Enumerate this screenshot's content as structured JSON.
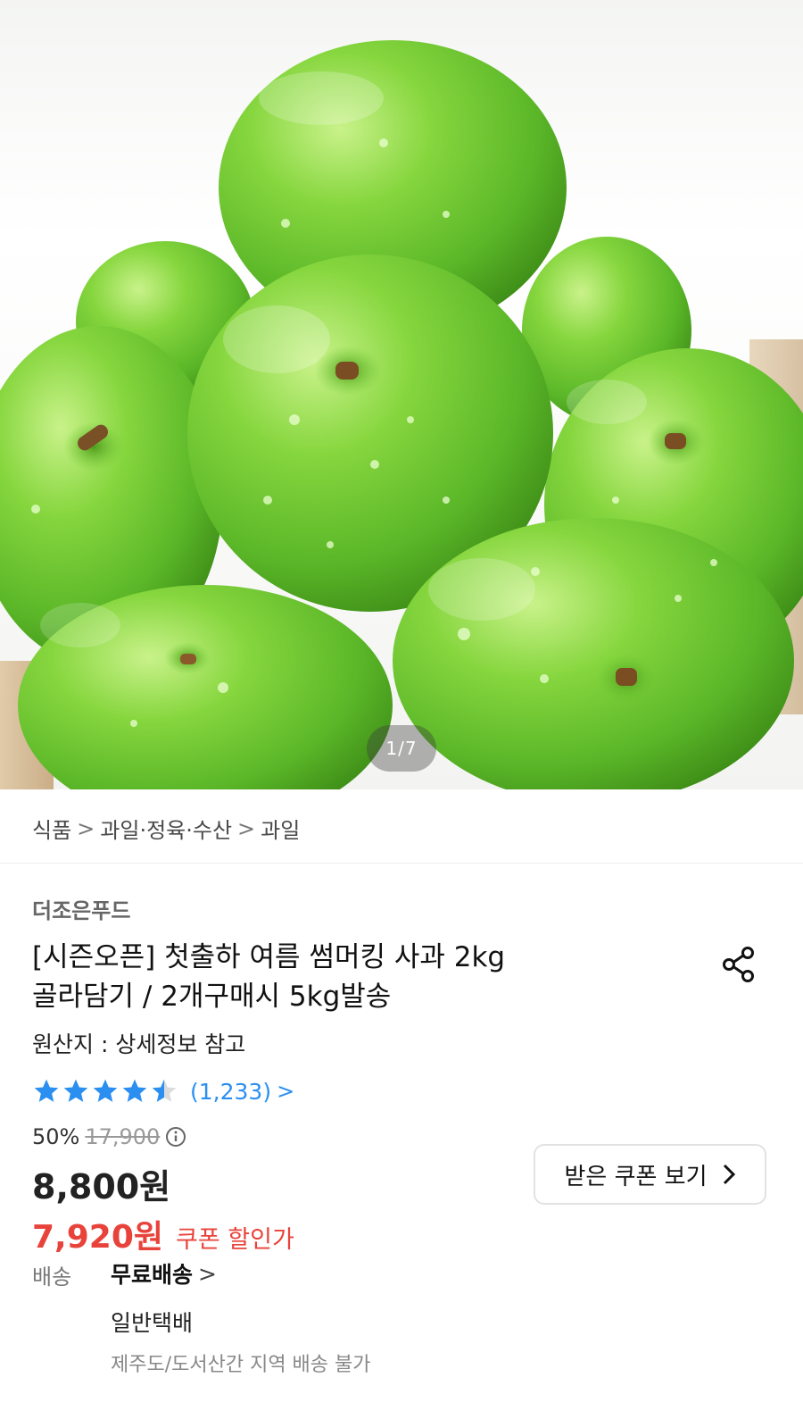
{
  "gallery": {
    "counter": "1/7",
    "image_subject": "green-apples"
  },
  "breadcrumb": {
    "items": [
      "식품",
      "과일·정육·수산",
      "과일"
    ],
    "separator": ">"
  },
  "product": {
    "seller": "더조은푸드",
    "title_line1": "[시즌오픈] 첫출하 여름 썸머킹 사과 2kg",
    "title_line2": "골라담기 / 2개구매시 5kg발송",
    "origin": "원산지 : 상세정보 참고",
    "rating": {
      "stars": 4.5,
      "max_stars": 5,
      "review_count": "(1,233)",
      "chevron": ">"
    },
    "pricing": {
      "discount": "50%",
      "original_price": "17,900",
      "price": "8,800원",
      "coupon_price": "7,920원",
      "coupon_label": "쿠폰 할인가"
    },
    "coupon_button": {
      "label": "받은 쿠폰 보기",
      "chevron": ">"
    },
    "shipping": {
      "label": "배송",
      "value": "무료배송",
      "chevron": ">",
      "type": "일반택배",
      "note": "제주도/도서산간 지역 배송 불가"
    }
  },
  "colors": {
    "accent_red": "#e8433b",
    "link_blue": "#2a8ff0",
    "star_blue": "#2a8ff0",
    "apple_green": "#6cc832"
  }
}
